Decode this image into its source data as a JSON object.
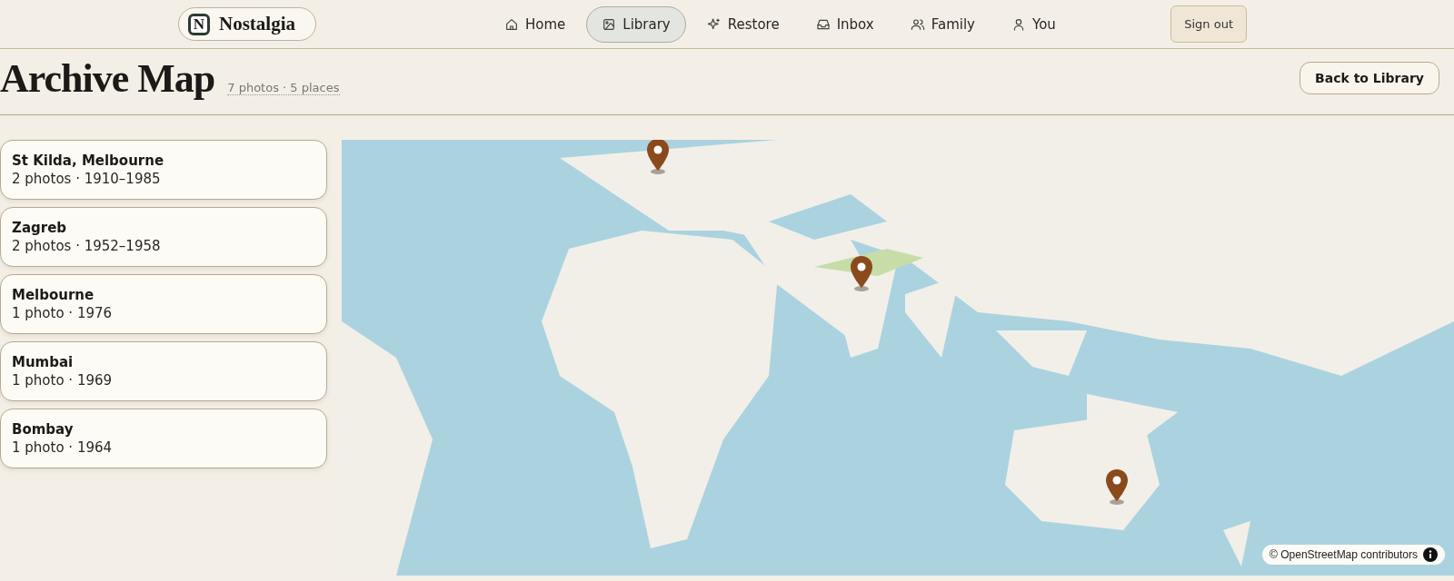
{
  "brand": {
    "name": "Nostalgia",
    "logo_letter": "N"
  },
  "nav": [
    {
      "label": "Home",
      "selected": false
    },
    {
      "label": "Library",
      "selected": true
    },
    {
      "label": "Restore",
      "selected": false
    },
    {
      "label": "Inbox",
      "selected": false
    },
    {
      "label": "Family",
      "selected": false
    },
    {
      "label": "You",
      "selected": false
    }
  ],
  "sign_out": "Sign out",
  "page": {
    "title": "Archive Map",
    "summary": "7 photos · 5 places",
    "back_button": "Back to Library"
  },
  "places": [
    {
      "name": "St Kilda, Melbourne",
      "detail": "2 photos · 1910–1985"
    },
    {
      "name": "Zagreb",
      "detail": "2 photos · 1952–1958"
    },
    {
      "name": "Melbourne",
      "detail": "1 photo · 1976"
    },
    {
      "name": "Mumbai",
      "detail": "1 photo · 1969"
    },
    {
      "name": "Bombay",
      "detail": "1 photo · 1964"
    }
  ],
  "map": {
    "kind": "picture",
    "attribution": "© OpenStreetMap contributors"
  }
}
